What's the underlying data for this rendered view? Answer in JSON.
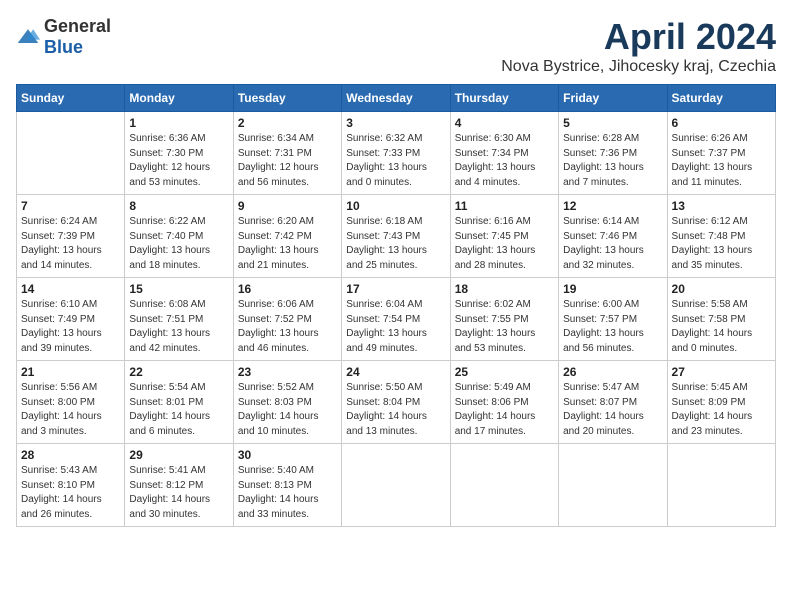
{
  "header": {
    "logo_general": "General",
    "logo_blue": "Blue",
    "month_title": "April 2024",
    "location": "Nova Bystrice, Jihocesky kraj, Czechia"
  },
  "weekdays": [
    "Sunday",
    "Monday",
    "Tuesday",
    "Wednesday",
    "Thursday",
    "Friday",
    "Saturday"
  ],
  "weeks": [
    [
      {
        "day": "",
        "info": ""
      },
      {
        "day": "1",
        "info": "Sunrise: 6:36 AM\nSunset: 7:30 PM\nDaylight: 12 hours\nand 53 minutes."
      },
      {
        "day": "2",
        "info": "Sunrise: 6:34 AM\nSunset: 7:31 PM\nDaylight: 12 hours\nand 56 minutes."
      },
      {
        "day": "3",
        "info": "Sunrise: 6:32 AM\nSunset: 7:33 PM\nDaylight: 13 hours\nand 0 minutes."
      },
      {
        "day": "4",
        "info": "Sunrise: 6:30 AM\nSunset: 7:34 PM\nDaylight: 13 hours\nand 4 minutes."
      },
      {
        "day": "5",
        "info": "Sunrise: 6:28 AM\nSunset: 7:36 PM\nDaylight: 13 hours\nand 7 minutes."
      },
      {
        "day": "6",
        "info": "Sunrise: 6:26 AM\nSunset: 7:37 PM\nDaylight: 13 hours\nand 11 minutes."
      }
    ],
    [
      {
        "day": "7",
        "info": "Sunrise: 6:24 AM\nSunset: 7:39 PM\nDaylight: 13 hours\nand 14 minutes."
      },
      {
        "day": "8",
        "info": "Sunrise: 6:22 AM\nSunset: 7:40 PM\nDaylight: 13 hours\nand 18 minutes."
      },
      {
        "day": "9",
        "info": "Sunrise: 6:20 AM\nSunset: 7:42 PM\nDaylight: 13 hours\nand 21 minutes."
      },
      {
        "day": "10",
        "info": "Sunrise: 6:18 AM\nSunset: 7:43 PM\nDaylight: 13 hours\nand 25 minutes."
      },
      {
        "day": "11",
        "info": "Sunrise: 6:16 AM\nSunset: 7:45 PM\nDaylight: 13 hours\nand 28 minutes."
      },
      {
        "day": "12",
        "info": "Sunrise: 6:14 AM\nSunset: 7:46 PM\nDaylight: 13 hours\nand 32 minutes."
      },
      {
        "day": "13",
        "info": "Sunrise: 6:12 AM\nSunset: 7:48 PM\nDaylight: 13 hours\nand 35 minutes."
      }
    ],
    [
      {
        "day": "14",
        "info": "Sunrise: 6:10 AM\nSunset: 7:49 PM\nDaylight: 13 hours\nand 39 minutes."
      },
      {
        "day": "15",
        "info": "Sunrise: 6:08 AM\nSunset: 7:51 PM\nDaylight: 13 hours\nand 42 minutes."
      },
      {
        "day": "16",
        "info": "Sunrise: 6:06 AM\nSunset: 7:52 PM\nDaylight: 13 hours\nand 46 minutes."
      },
      {
        "day": "17",
        "info": "Sunrise: 6:04 AM\nSunset: 7:54 PM\nDaylight: 13 hours\nand 49 minutes."
      },
      {
        "day": "18",
        "info": "Sunrise: 6:02 AM\nSunset: 7:55 PM\nDaylight: 13 hours\nand 53 minutes."
      },
      {
        "day": "19",
        "info": "Sunrise: 6:00 AM\nSunset: 7:57 PM\nDaylight: 13 hours\nand 56 minutes."
      },
      {
        "day": "20",
        "info": "Sunrise: 5:58 AM\nSunset: 7:58 PM\nDaylight: 14 hours\nand 0 minutes."
      }
    ],
    [
      {
        "day": "21",
        "info": "Sunrise: 5:56 AM\nSunset: 8:00 PM\nDaylight: 14 hours\nand 3 minutes."
      },
      {
        "day": "22",
        "info": "Sunrise: 5:54 AM\nSunset: 8:01 PM\nDaylight: 14 hours\nand 6 minutes."
      },
      {
        "day": "23",
        "info": "Sunrise: 5:52 AM\nSunset: 8:03 PM\nDaylight: 14 hours\nand 10 minutes."
      },
      {
        "day": "24",
        "info": "Sunrise: 5:50 AM\nSunset: 8:04 PM\nDaylight: 14 hours\nand 13 minutes."
      },
      {
        "day": "25",
        "info": "Sunrise: 5:49 AM\nSunset: 8:06 PM\nDaylight: 14 hours\nand 17 minutes."
      },
      {
        "day": "26",
        "info": "Sunrise: 5:47 AM\nSunset: 8:07 PM\nDaylight: 14 hours\nand 20 minutes."
      },
      {
        "day": "27",
        "info": "Sunrise: 5:45 AM\nSunset: 8:09 PM\nDaylight: 14 hours\nand 23 minutes."
      }
    ],
    [
      {
        "day": "28",
        "info": "Sunrise: 5:43 AM\nSunset: 8:10 PM\nDaylight: 14 hours\nand 26 minutes."
      },
      {
        "day": "29",
        "info": "Sunrise: 5:41 AM\nSunset: 8:12 PM\nDaylight: 14 hours\nand 30 minutes."
      },
      {
        "day": "30",
        "info": "Sunrise: 5:40 AM\nSunset: 8:13 PM\nDaylight: 14 hours\nand 33 minutes."
      },
      {
        "day": "",
        "info": ""
      },
      {
        "day": "",
        "info": ""
      },
      {
        "day": "",
        "info": ""
      },
      {
        "day": "",
        "info": ""
      }
    ]
  ]
}
